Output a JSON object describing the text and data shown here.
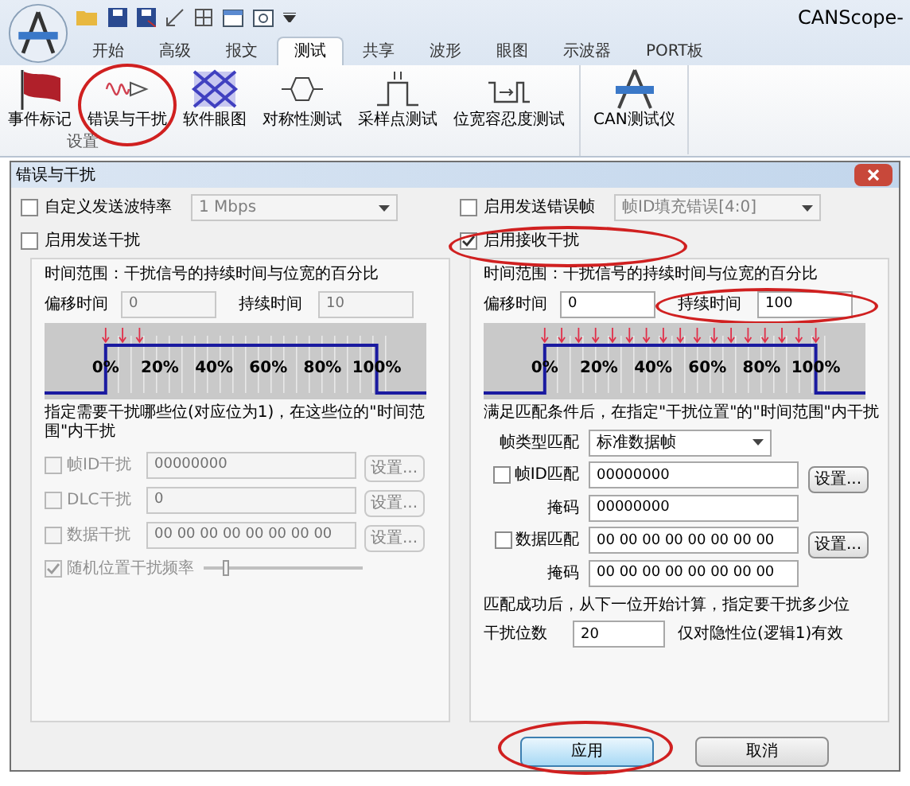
{
  "app": {
    "title": "CANScope-",
    "tabs": [
      {
        "label": "开始",
        "selected": false
      },
      {
        "label": "高级",
        "selected": false
      },
      {
        "label": "报文",
        "selected": false
      },
      {
        "label": "测试",
        "selected": true
      },
      {
        "label": "共享",
        "selected": false
      },
      {
        "label": "波形",
        "selected": false
      },
      {
        "label": "眼图",
        "selected": false
      },
      {
        "label": "示波器",
        "selected": false
      },
      {
        "label": "PORT板",
        "selected": false
      }
    ],
    "ribbon": {
      "buttons": [
        {
          "label": "事件标记"
        },
        {
          "label": "错误与干扰"
        },
        {
          "label": "软件眼图"
        },
        {
          "label": "对称性测试"
        },
        {
          "label": "采样点测试"
        },
        {
          "label": "位宽容忍度测试"
        }
      ],
      "group_label": "设置",
      "extra_button": {
        "label": "CAN测试仪"
      }
    }
  },
  "dialog": {
    "title": "错误与干扰",
    "left": {
      "top": {
        "label": "自定义发送波特率",
        "checked": false,
        "value": "1 Mbps",
        "disabled": true
      },
      "enable": {
        "label": "启用发送干扰",
        "checked": false
      },
      "range_text": "时间范围：干扰信号的持续时间与位宽的百分比",
      "offset": {
        "label": "偏移时间",
        "value": "0",
        "disabled": true
      },
      "duration": {
        "label": "持续时间",
        "value": "10",
        "disabled": true
      },
      "percent_labels": [
        "0%",
        "20%",
        "40%",
        "60%",
        "80%",
        "100%"
      ],
      "note": "指定需要干扰哪些位(对应位为1)，在这些位的\"时间范围\"内干扰",
      "rows": [
        {
          "label": "帧ID干扰",
          "checked": false,
          "value": "00000000",
          "button": "设置...",
          "disabled": true
        },
        {
          "label": "DLC干扰",
          "checked": false,
          "value": "0",
          "button": "设置...",
          "disabled": true
        },
        {
          "label": "数据干扰",
          "checked": false,
          "value": "00 00 00 00 00 00 00 00",
          "button": "设置...",
          "disabled": true
        }
      ],
      "random": {
        "label": "随机位置干扰频率",
        "checked": true,
        "disabled": true,
        "level": 0.12
      }
    },
    "right": {
      "top": {
        "label": "启用发送错误帧",
        "checked": false,
        "value": "帧ID填充错误[4:0]",
        "disabled": true
      },
      "enable": {
        "label": "启用接收干扰",
        "checked": true
      },
      "range_text": "时间范围：干扰信号的持续时间与位宽的百分比",
      "offset": {
        "label": "偏移时间",
        "value": "0",
        "disabled": false
      },
      "duration": {
        "label": "持续时间",
        "value": "100",
        "disabled": false
      },
      "percent_labels": [
        "0%",
        "20%",
        "40%",
        "60%",
        "80%",
        "100%"
      ],
      "note": "满足匹配条件后，在指定\"干扰位置\"的\"时间范围\"内干扰",
      "rows": [
        {
          "kind": "select",
          "label": "帧类型匹配",
          "value": "标准数据帧"
        },
        {
          "kind": "check",
          "label": "帧ID匹配",
          "checked": false,
          "value": "00000000",
          "button": "设置..."
        },
        {
          "kind": "mask",
          "label": "掩码",
          "value": "00000000"
        },
        {
          "kind": "check",
          "label": "数据匹配",
          "checked": false,
          "value": "00 00 00 00 00 00 00 00",
          "button": "设置..."
        },
        {
          "kind": "mask",
          "label": "掩码",
          "value": "00 00 00 00 00 00 00 00"
        }
      ],
      "count_text": "匹配成功后，从下一位开始计算，指定要干扰多少位",
      "count": {
        "label": "干扰位数",
        "value": "20",
        "hint": "仅对隐性位(逻辑1)有效"
      }
    },
    "buttons": [
      {
        "label": "应用",
        "default": true
      },
      {
        "label": "取消",
        "default": false
      }
    ]
  }
}
